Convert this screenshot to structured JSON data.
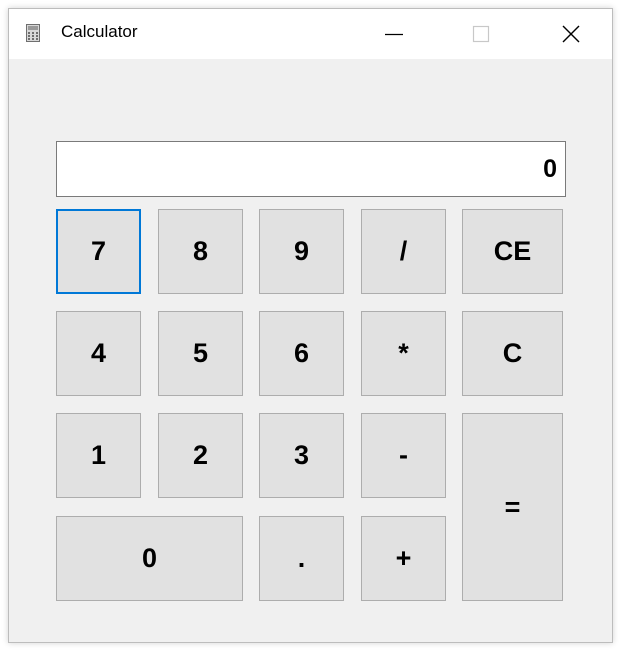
{
  "window": {
    "title": "Calculator",
    "app_icon": "calculator-icon",
    "controls": {
      "minimize_icon": "minimize-icon",
      "maximize_icon": "maximize-icon",
      "close_icon": "close-icon"
    }
  },
  "display": {
    "value": "0"
  },
  "keys": {
    "seven": "7",
    "eight": "8",
    "nine": "9",
    "divide": "/",
    "clear_entry": "CE",
    "four": "4",
    "five": "5",
    "six": "6",
    "multiply": "*",
    "clear": "C",
    "one": "1",
    "two": "2",
    "three": "3",
    "subtract": "-",
    "equals": "=",
    "zero": "0",
    "decimal": ".",
    "add": "+"
  },
  "colors": {
    "focus_accent": "#0078d7",
    "key_background": "#e1e1e1",
    "window_background": "#f0f0f0"
  }
}
